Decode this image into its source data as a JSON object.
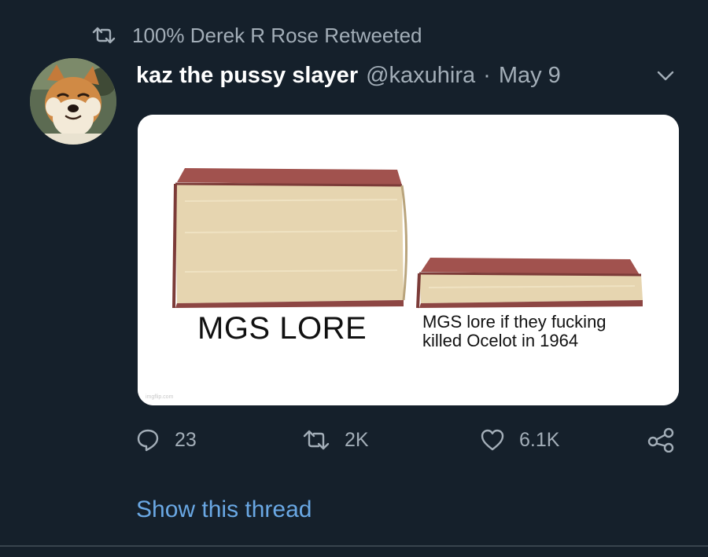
{
  "retweet": {
    "icon": "retweet-icon",
    "text": "100% Derek R Rose Retweeted"
  },
  "author": {
    "avatar": "shiba-inu-avatar",
    "name": "kaz the pussy slayer",
    "handle": "@kaxuhira",
    "separator": "·",
    "date": "May 9",
    "menu_icon": "chevron-down-icon"
  },
  "media": {
    "type": "image",
    "description_icon": "book-meme-image",
    "big_book_caption": "MGS LORE",
    "small_book_caption_line1": "MGS lore if they fucking",
    "small_book_caption_line2": "killed Ocelot in 1964",
    "watermark": "imgflip.com"
  },
  "actions": {
    "reply": {
      "icon": "reply-icon",
      "count": "23"
    },
    "retweet": {
      "icon": "retweet-icon",
      "count": "2K"
    },
    "like": {
      "icon": "heart-icon",
      "count": "6.1K"
    },
    "share": {
      "icon": "share-icon"
    }
  },
  "show_thread": "Show this thread",
  "colors": {
    "background": "#15202b",
    "primary_text": "#ffffff",
    "secondary_text": "#a3aeb8",
    "link": "#6aa8e4",
    "divider": "#38444d"
  }
}
